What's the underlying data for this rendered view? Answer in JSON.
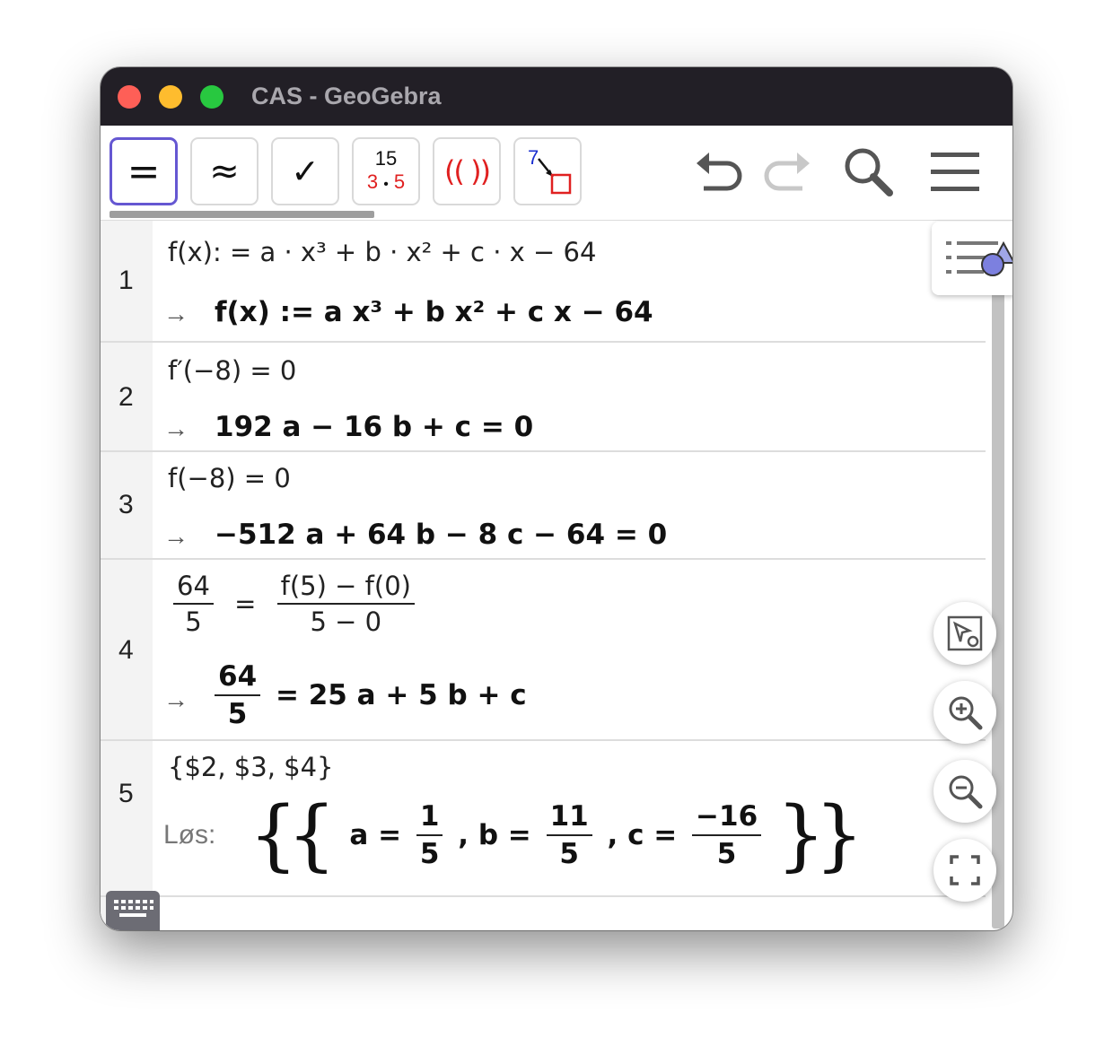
{
  "window": {
    "title": "CAS - GeoGebra"
  },
  "toolbar": {
    "evaluate": "=",
    "numeric": "≈",
    "keep_input": "✓",
    "factor_top": "15",
    "factor_left": "3",
    "factor_dot": "•",
    "factor_right": "5",
    "expand": "(( ))",
    "substitute_num": "7"
  },
  "cells": [
    {
      "number": "1",
      "input": "f(x): = a · x³ + b · x² + c · x − 64",
      "arrow": "→",
      "output": "f(x) := a x³ + b x² + c x − 64"
    },
    {
      "number": "2",
      "input": "f′(−8) = 0",
      "arrow": "→",
      "output": "192 a − 16 b + c = 0"
    },
    {
      "number": "3",
      "input": "f(−8) = 0",
      "arrow": "→",
      "output": "−512 a + 64 b − 8 c − 64 = 0"
    },
    {
      "number": "4",
      "input_lhs_num": "64",
      "input_lhs_den": "5",
      "input_eq": "=",
      "input_rhs_num": "f(5) − f(0)",
      "input_rhs_den": "5 − 0",
      "arrow": "→",
      "output_lhs_num": "64",
      "output_lhs_den": "5",
      "output_rhs": "= 25 a + 5 b + c"
    },
    {
      "number": "5",
      "input": "{$2, $3, $4}",
      "solve_label": "Løs:",
      "open_braces": "{{",
      "a_label": "a =",
      "a_num": "1",
      "a_den": "5",
      "b_label": ", b =",
      "b_num": "11",
      "b_den": "5",
      "c_label": ", c =",
      "c_num": "−16",
      "c_den": "5",
      "close_braces": "}}"
    }
  ],
  "icons": {
    "undo": "undo-icon",
    "redo": "redo-icon",
    "search": "search-icon",
    "menu": "menu-icon",
    "style_bar": "style-bar-icon",
    "graphics": "graphics-view-icon",
    "zoom_in": "zoom-in-icon",
    "zoom_out": "zoom-out-icon",
    "fullscreen": "fullscreen-icon",
    "keyboard": "keyboard-icon"
  }
}
